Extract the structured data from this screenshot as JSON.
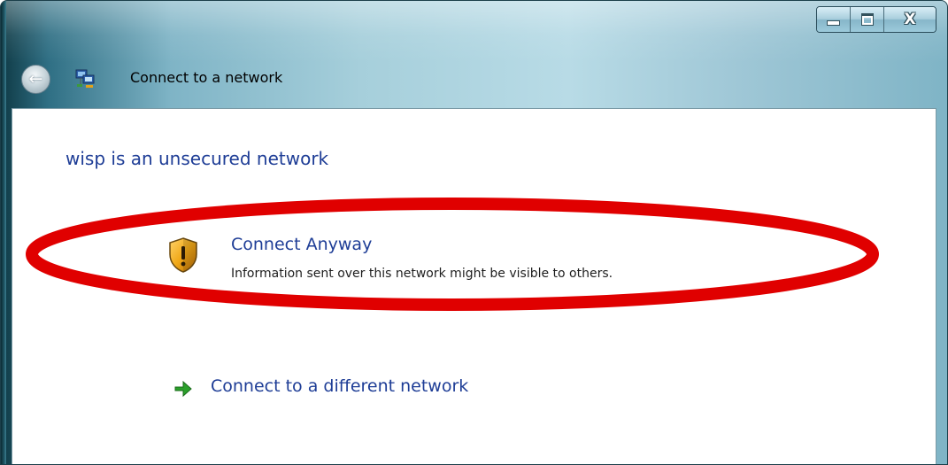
{
  "window": {
    "title": "Connect to a network",
    "caption_buttons": [
      {
        "name": "minimize",
        "icon": "minimize-icon"
      },
      {
        "name": "maximize",
        "icon": "maximize-icon"
      },
      {
        "name": "close",
        "icon": "close-icon"
      }
    ]
  },
  "nav": {
    "back_icon": "back-arrow-icon",
    "app_icon": "network-icon"
  },
  "main": {
    "heading": "wisp is an unsecured network",
    "options": [
      {
        "label": "Connect Anyway",
        "description": "Information sent over this network might be visible to others.",
        "icon": "security-shield-warning-icon"
      },
      {
        "label": "Connect to a different network",
        "icon": "green-arrow-icon"
      }
    ]
  },
  "annotation": {
    "color": "#e00000",
    "shape": "ellipse",
    "target": "Connect Anyway"
  },
  "colors": {
    "link_blue": "#1e3d96",
    "title_bar": "#a6cfdb",
    "warning_shield": "#f0a818",
    "arrow_green": "#2aa02a"
  }
}
